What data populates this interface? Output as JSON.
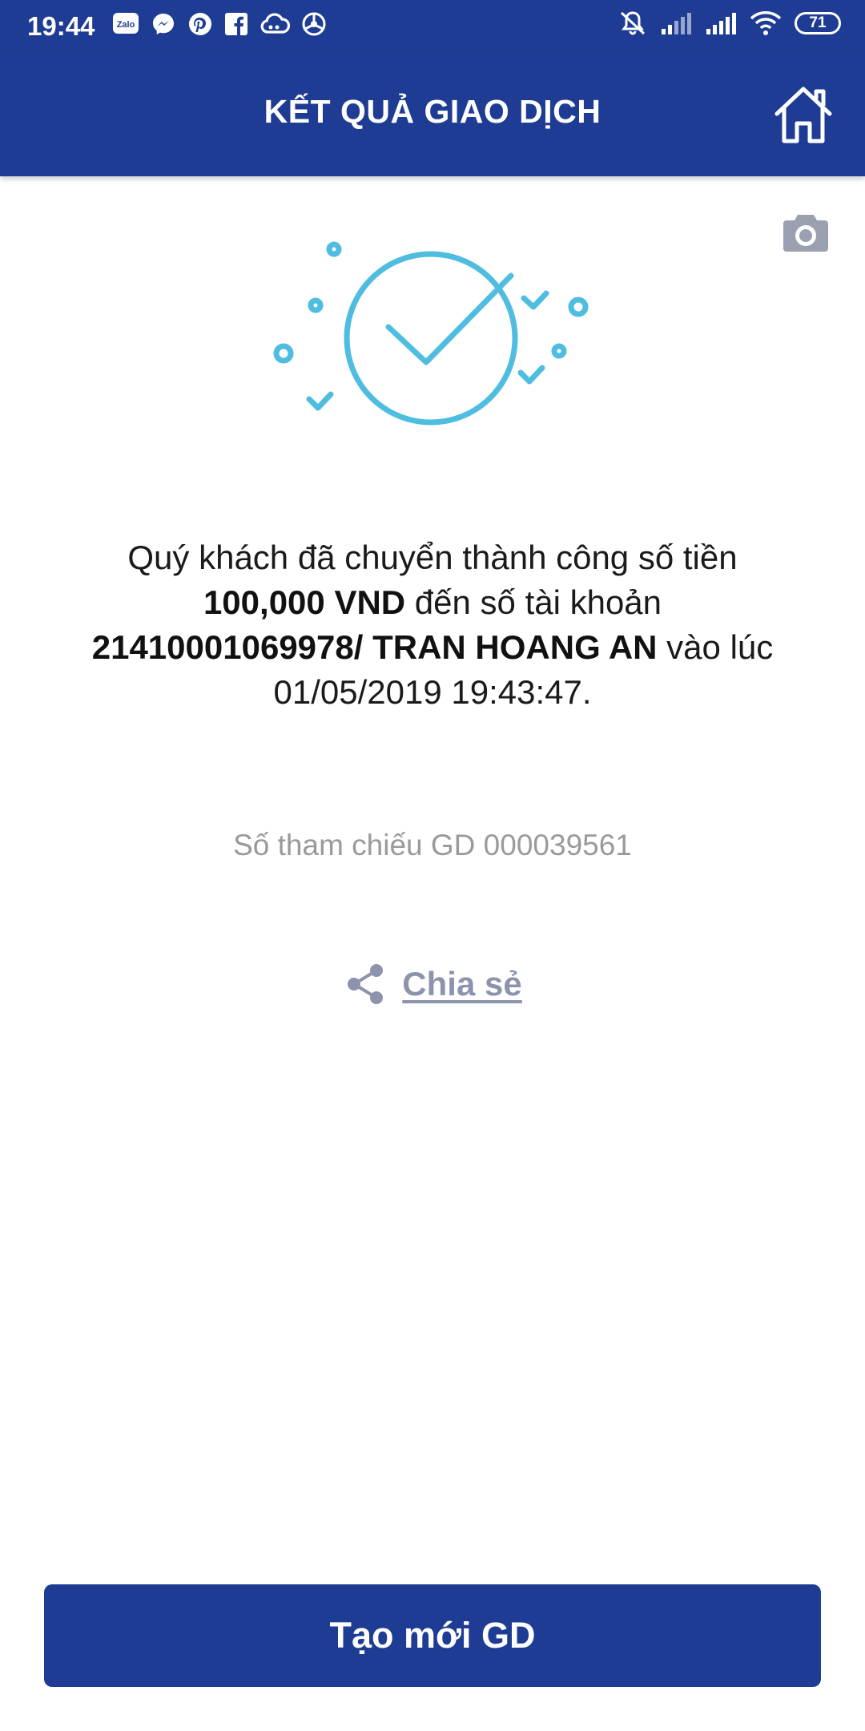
{
  "status_bar": {
    "time": "19:44",
    "battery": "71",
    "left_icons": [
      "zalo-icon",
      "messenger-icon",
      "pinterest-icon",
      "facebook-icon",
      "cloud-icon",
      "browser-icon"
    ],
    "right_icons": [
      "mute-icon",
      "signal-icon",
      "signal-icon",
      "wifi-icon",
      "battery-icon"
    ]
  },
  "header": {
    "title": "KẾT QUẢ GIAO DỊCH",
    "home_icon": "home-icon"
  },
  "camera_icon": "camera-icon",
  "illustration_icon": "success-check-icon",
  "message": {
    "part1": "Quý khách đã chuyển thành công số tiền ",
    "amount": "100,000 VND",
    "part2": " đến số tài khoản ",
    "account": "21410001069978/ TRAN HOANG AN",
    "part3": " vào lúc 01/05/2019 19:43:47."
  },
  "reference": "Số tham chiếu GD 000039561",
  "share": {
    "label": "Chia sẻ",
    "icon": "share-icon"
  },
  "primary_button": {
    "label": "Tạo mới GD"
  },
  "colors": {
    "brand": "#1e3c93",
    "accent": "#4fbde0",
    "muted": "#9a9a9a",
    "share": "#8d93ad"
  }
}
